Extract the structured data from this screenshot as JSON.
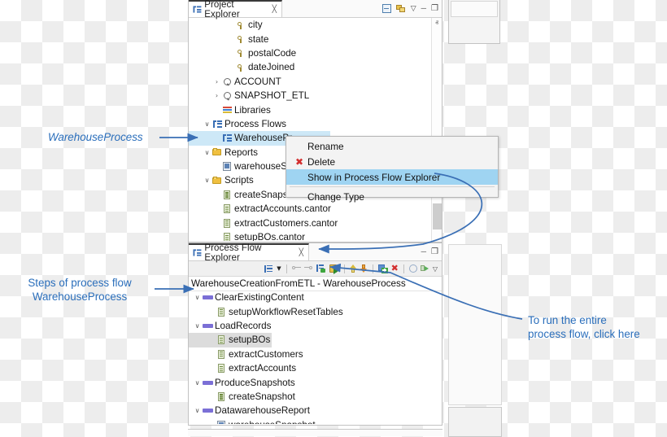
{
  "project_explorer": {
    "tab_label": "Project Explorer",
    "close_glyph": "╳",
    "toolbar": {
      "collapse_all": "collapse-all",
      "link_editor": "link-with-editor",
      "view_menu": "▽",
      "minimize": "─",
      "maximize": "❐"
    },
    "tree": [
      {
        "label": "city",
        "icon": "attribute",
        "indent": 3,
        "twisty": "",
        "type": "leaf"
      },
      {
        "label": "state",
        "icon": "attribute",
        "indent": 3,
        "twisty": "",
        "type": "leaf"
      },
      {
        "label": "postalCode",
        "icon": "attribute",
        "indent": 3,
        "twisty": "",
        "type": "leaf"
      },
      {
        "label": "dateJoined",
        "icon": "attribute",
        "indent": 3,
        "twisty": "",
        "type": "leaf"
      },
      {
        "label": "ACCOUNT",
        "icon": "entity",
        "indent": 2,
        "twisty": "›",
        "type": "node"
      },
      {
        "label": "SNAPSHOT_ETL",
        "icon": "entity",
        "indent": 2,
        "twisty": "›",
        "type": "node"
      },
      {
        "label": "Libraries",
        "icon": "libraries",
        "indent": 2,
        "twisty": "",
        "type": "leaf"
      },
      {
        "label": "Process Flows",
        "icon": "flow",
        "indent": 1,
        "twisty": "∨",
        "type": "node"
      },
      {
        "label": "WarehousePr",
        "icon": "flow",
        "indent": 2,
        "twisty": "",
        "type": "leaf",
        "selected": true
      },
      {
        "label": "Reports",
        "icon": "folder",
        "indent": 1,
        "twisty": "∨",
        "type": "node"
      },
      {
        "label": "warehouseSn",
        "icon": "report",
        "indent": 2,
        "twisty": "",
        "type": "leaf"
      },
      {
        "label": "Scripts",
        "icon": "folder",
        "indent": 1,
        "twisty": "∨",
        "type": "node"
      },
      {
        "label": "createSnapsh",
        "icon": "script",
        "indent": 2,
        "twisty": "",
        "type": "leaf"
      },
      {
        "label": "extractAccounts.cantor",
        "icon": "script",
        "indent": 2,
        "twisty": "",
        "type": "leaf"
      },
      {
        "label": "extractCustomers.cantor",
        "icon": "script",
        "indent": 2,
        "twisty": "",
        "type": "leaf"
      },
      {
        "label": "setupBOs.cantor",
        "icon": "script",
        "indent": 2,
        "twisty": "",
        "type": "leaf"
      }
    ],
    "scrollbar": {
      "up": "ⱏ",
      "down": "ⱟ"
    }
  },
  "context_menu": {
    "items": [
      {
        "label": "Rename",
        "icon": "none",
        "highlighted": false
      },
      {
        "label": "Delete",
        "icon": "delete-x",
        "highlighted": false
      },
      {
        "label": "Show in Process Flow Explorer",
        "icon": "none",
        "highlighted": true
      },
      {
        "label": "Change Type",
        "icon": "none",
        "highlighted": false
      }
    ]
  },
  "process_flow_explorer": {
    "tab_label": "Process Flow Explorer",
    "close_glyph": "╳",
    "window_buttons": {
      "minimize": "─",
      "maximize": "❐"
    },
    "toolbar_icons": [
      "layout-flow-icon",
      "dropdown-arrow-icon",
      "separator",
      "collapse-step-icon",
      "expand-step-icon",
      "show-flow-icon",
      "run-flow-icon",
      "separator",
      "move-up-icon",
      "move-down-icon",
      "separator",
      "add-step-icon",
      "delete-step-icon",
      "separator",
      "info-icon",
      "debug-run-icon",
      "view-menu-icon"
    ],
    "breadcrumb": "WarehouseCreationFromETL - WarehouseProcess",
    "tree": [
      {
        "label": "ClearExistingContent",
        "icon": "step-group",
        "indent": 0,
        "twisty": "∨"
      },
      {
        "label": "setupWorkflowResetTables",
        "icon": "script",
        "indent": 1,
        "twisty": ""
      },
      {
        "label": "LoadRecords",
        "icon": "step-group",
        "indent": 0,
        "twisty": "∨"
      },
      {
        "label": "setupBOs",
        "icon": "script",
        "indent": 1,
        "twisty": "",
        "selected": true
      },
      {
        "label": "extractCustomers",
        "icon": "script",
        "indent": 1,
        "twisty": ""
      },
      {
        "label": "extractAccounts",
        "icon": "script",
        "indent": 1,
        "twisty": ""
      },
      {
        "label": "ProduceSnapshots",
        "icon": "step-group",
        "indent": 0,
        "twisty": "∨"
      },
      {
        "label": "createSnapshot",
        "icon": "script",
        "indent": 1,
        "twisty": ""
      },
      {
        "label": "DatawarehouseReport",
        "icon": "step-group",
        "indent": 0,
        "twisty": "∨"
      },
      {
        "label": "warehouseSnapshot",
        "icon": "report",
        "indent": 1,
        "twisty": ""
      }
    ]
  },
  "annotations": {
    "warehouse_process": "WarehouseProcess",
    "steps_line1": "Steps of process flow",
    "steps_line2": "WarehouseProcess",
    "run_line1": "To run the entire",
    "run_line2": "process flow, click here"
  },
  "colors": {
    "annotation_blue": "#2a6ebb",
    "selection_blue": "#cde8f7",
    "menu_highlight": "#9fd4f2",
    "panel_border": "#c2c2c2"
  }
}
